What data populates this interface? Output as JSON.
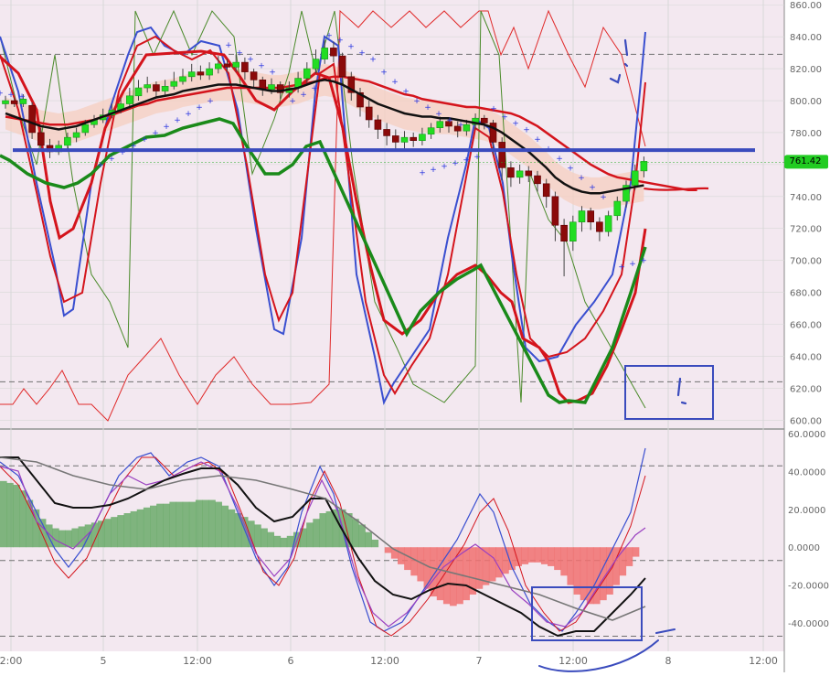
{
  "colors": {
    "background": "#ffffff",
    "pane_fill": "#f3e8f0",
    "grid": "#d7d7d7",
    "dashed_level": "#707070",
    "candle_up": "#22dd22",
    "candle_down": "#8b0a0a",
    "ma_black": "#111111",
    "ma_red": "#d4141c",
    "ma_green": "#1a8a1a",
    "osc_blue": "#3a4fd0",
    "psar_blue": "#2a36e0",
    "zigzag_red": "#e02a2a",
    "zigzag_green": "#4a8a2a",
    "annotation_blue": "#3a4bbd",
    "price_tag_bg": "#22cc22",
    "hist_red": "#f07070",
    "hist_green": "#6aaa6a",
    "envelope_fill": "#f5cfc0"
  },
  "chart_data": [
    {
      "type": "line",
      "pane": "price",
      "y_ticks": [
        "860.00",
        "840.00",
        "820.00",
        "800.00",
        "780.00",
        "760.00",
        "740.00",
        "720.00",
        "700.00",
        "680.00",
        "660.00",
        "640.00",
        "620.00",
        "600.00"
      ],
      "ylim": [
        595,
        863
      ],
      "x_ticks": [
        "2:00",
        "5",
        "12:00",
        "6",
        "12:00",
        "7",
        "12:00",
        "8",
        "12:00"
      ],
      "current_price_label": "761.42",
      "current_price": 761.42,
      "dashed_levels": [
        829,
        624
      ],
      "horizontal_line": 769,
      "candles": [
        {
          "o": 798,
          "c": 800,
          "h": 803,
          "l": 795
        },
        {
          "o": 800,
          "c": 798,
          "h": 802,
          "l": 796
        },
        {
          "o": 798,
          "c": 801,
          "h": 804,
          "l": 796
        },
        {
          "o": 797,
          "c": 780,
          "h": 799,
          "l": 776
        },
        {
          "o": 780,
          "c": 772,
          "h": 783,
          "l": 768
        },
        {
          "o": 772,
          "c": 768,
          "h": 776,
          "l": 764
        },
        {
          "o": 768,
          "c": 772,
          "h": 775,
          "l": 766
        },
        {
          "o": 772,
          "c": 777,
          "h": 780,
          "l": 770
        },
        {
          "o": 777,
          "c": 780,
          "h": 783,
          "l": 774
        },
        {
          "o": 780,
          "c": 785,
          "h": 788,
          "l": 778
        },
        {
          "o": 785,
          "c": 788,
          "h": 791,
          "l": 783
        },
        {
          "o": 788,
          "c": 791,
          "h": 795,
          "l": 786
        },
        {
          "o": 791,
          "c": 794,
          "h": 798,
          "l": 789
        },
        {
          "o": 794,
          "c": 798,
          "h": 802,
          "l": 792
        },
        {
          "o": 798,
          "c": 803,
          "h": 808,
          "l": 795
        },
        {
          "o": 803,
          "c": 808,
          "h": 813,
          "l": 800
        },
        {
          "o": 808,
          "c": 810,
          "h": 815,
          "l": 805
        },
        {
          "o": 810,
          "c": 806,
          "h": 812,
          "l": 802
        },
        {
          "o": 806,
          "c": 809,
          "h": 813,
          "l": 803
        },
        {
          "o": 809,
          "c": 812,
          "h": 818,
          "l": 807
        },
        {
          "o": 812,
          "c": 815,
          "h": 820,
          "l": 810
        },
        {
          "o": 815,
          "c": 818,
          "h": 823,
          "l": 812
        },
        {
          "o": 818,
          "c": 816,
          "h": 822,
          "l": 813
        },
        {
          "o": 816,
          "c": 820,
          "h": 824,
          "l": 813
        },
        {
          "o": 820,
          "c": 823,
          "h": 828,
          "l": 817
        },
        {
          "o": 823,
          "c": 821,
          "h": 826,
          "l": 818
        },
        {
          "o": 821,
          "c": 824,
          "h": 829,
          "l": 818
        },
        {
          "o": 824,
          "c": 818,
          "h": 827,
          "l": 813
        },
        {
          "o": 818,
          "c": 813,
          "h": 820,
          "l": 808
        },
        {
          "o": 813,
          "c": 807,
          "h": 815,
          "l": 803
        },
        {
          "o": 807,
          "c": 810,
          "h": 814,
          "l": 804
        },
        {
          "o": 810,
          "c": 805,
          "h": 812,
          "l": 801
        },
        {
          "o": 805,
          "c": 808,
          "h": 812,
          "l": 802
        },
        {
          "o": 808,
          "c": 814,
          "h": 818,
          "l": 805
        },
        {
          "o": 814,
          "c": 820,
          "h": 824,
          "l": 811
        },
        {
          "o": 820,
          "c": 826,
          "h": 832,
          "l": 817
        },
        {
          "o": 826,
          "c": 833,
          "h": 838,
          "l": 823
        },
        {
          "o": 833,
          "c": 828,
          "h": 837,
          "l": 824
        },
        {
          "o": 828,
          "c": 815,
          "h": 830,
          "l": 810
        },
        {
          "o": 815,
          "c": 805,
          "h": 818,
          "l": 800
        },
        {
          "o": 805,
          "c": 796,
          "h": 808,
          "l": 790
        },
        {
          "o": 796,
          "c": 788,
          "h": 800,
          "l": 783
        },
        {
          "o": 788,
          "c": 782,
          "h": 791,
          "l": 776
        },
        {
          "o": 782,
          "c": 778,
          "h": 786,
          "l": 772
        },
        {
          "o": 778,
          "c": 774,
          "h": 782,
          "l": 768
        },
        {
          "o": 774,
          "c": 777,
          "h": 781,
          "l": 770
        },
        {
          "o": 777,
          "c": 775,
          "h": 780,
          "l": 771
        },
        {
          "o": 775,
          "c": 779,
          "h": 783,
          "l": 772
        },
        {
          "o": 779,
          "c": 783,
          "h": 786,
          "l": 776
        },
        {
          "o": 783,
          "c": 787,
          "h": 790,
          "l": 780
        },
        {
          "o": 787,
          "c": 784,
          "h": 789,
          "l": 780
        },
        {
          "o": 784,
          "c": 781,
          "h": 787,
          "l": 777
        },
        {
          "o": 781,
          "c": 785,
          "h": 788,
          "l": 778
        },
        {
          "o": 785,
          "c": 789,
          "h": 792,
          "l": 782
        },
        {
          "o": 789,
          "c": 786,
          "h": 791,
          "l": 782
        },
        {
          "o": 786,
          "c": 774,
          "h": 788,
          "l": 766
        },
        {
          "o": 774,
          "c": 758,
          "h": 777,
          "l": 750
        },
        {
          "o": 758,
          "c": 752,
          "h": 762,
          "l": 746
        },
        {
          "o": 752,
          "c": 756,
          "h": 760,
          "l": 748
        },
        {
          "o": 756,
          "c": 753,
          "h": 759,
          "l": 749
        },
        {
          "o": 753,
          "c": 748,
          "h": 756,
          "l": 743
        },
        {
          "o": 748,
          "c": 740,
          "h": 751,
          "l": 733
        },
        {
          "o": 740,
          "c": 722,
          "h": 743,
          "l": 712
        },
        {
          "o": 722,
          "c": 712,
          "h": 726,
          "l": 690
        },
        {
          "o": 712,
          "c": 724,
          "h": 728,
          "l": 706
        },
        {
          "o": 724,
          "c": 731,
          "h": 734,
          "l": 718
        },
        {
          "o": 731,
          "c": 724,
          "h": 733,
          "l": 719
        },
        {
          "o": 724,
          "c": 718,
          "h": 727,
          "l": 712
        },
        {
          "o": 718,
          "c": 728,
          "h": 731,
          "l": 715
        },
        {
          "o": 728,
          "c": 737,
          "h": 740,
          "l": 725
        },
        {
          "o": 737,
          "c": 747,
          "h": 750,
          "l": 733
        },
        {
          "o": 747,
          "c": 756,
          "h": 760,
          "l": 744
        },
        {
          "o": 756,
          "c": 762,
          "h": 765,
          "l": 752
        }
      ],
      "ma_black": [
        792,
        790,
        788,
        786,
        784,
        783,
        782,
        783,
        784,
        786,
        788,
        790,
        792,
        794,
        796,
        798,
        800,
        802,
        803,
        804,
        806,
        807,
        808,
        809,
        810,
        810,
        810,
        809,
        808,
        807,
        806,
        806,
        807,
        808,
        810,
        812,
        813,
        812,
        810,
        807,
        804,
        801,
        798,
        796,
        794,
        792,
        791,
        790,
        790,
        789,
        789,
        788,
        787,
        786,
        785,
        783,
        780,
        776,
        772,
        768,
        763,
        758,
        752,
        748,
        745,
        743,
        742,
        742,
        743,
        744,
        745,
        746,
        747
      ],
      "ma_red": [
        790,
        789,
        788,
        787,
        786,
        785,
        785,
        785,
        786,
        787,
        788,
        790,
        791,
        793,
        795,
        797,
        798,
        800,
        801,
        802,
        803,
        804,
        805,
        806,
        807,
        808,
        808,
        808,
        808,
        808,
        808,
        808,
        809,
        810,
        811,
        812,
        814,
        815,
        815,
        814,
        813,
        812,
        810,
        808,
        806,
        804,
        803,
        801,
        800,
        799,
        798,
        797,
        796,
        796,
        795,
        794,
        793,
        792,
        790,
        787,
        784,
        780,
        776,
        772,
        768,
        764,
        760,
        757,
        754,
        752,
        751,
        750,
        749,
        748,
        747,
        746,
        745,
        744,
        744
      ],
      "ma_green": [
        null,
        null,
        null,
        null,
        null,
        null,
        null,
        null,
        null,
        null,
        null,
        null,
        null,
        null,
        null,
        null,
        null,
        null,
        null,
        null,
        null,
        null,
        null,
        null,
        null,
        null,
        null,
        null,
        null,
        null,
        null,
        null,
        null,
        null,
        null,
        null,
        null,
        null,
        null,
        null,
        null,
        null,
        null,
        null,
        null,
        null,
        null,
        null,
        null,
        null,
        null,
        null,
        null,
        null,
        null,
        null,
        null,
        null,
        null,
        null,
        null,
        null,
        null,
        null,
        null,
        null,
        null,
        null,
        null,
        null,
        null,
        null,
        null
      ],
      "psar_upper": [
        [
          0,
          805
        ],
        [
          12,
          804
        ],
        [
          24,
          803
        ],
        [
          250,
          835
        ],
        [
          262,
          830
        ],
        [
          274,
          826
        ],
        [
          286,
          822
        ],
        [
          298,
          818
        ],
        [
          360,
          841
        ],
        [
          372,
          838
        ],
        [
          384,
          834
        ],
        [
          396,
          830
        ],
        [
          408,
          826
        ],
        [
          420,
          818
        ],
        [
          432,
          812
        ],
        [
          444,
          806
        ],
        [
          456,
          800
        ],
        [
          468,
          796
        ],
        [
          480,
          792
        ],
        [
          492,
          788
        ],
        [
          504,
          785
        ],
        [
          540,
          795
        ],
        [
          552,
          790
        ],
        [
          564,
          786
        ],
        [
          576,
          782
        ],
        [
          588,
          776
        ],
        [
          600,
          770
        ],
        [
          612,
          764
        ],
        [
          624,
          758
        ],
        [
          636,
          752
        ],
        [
          648,
          746
        ],
        [
          660,
          740
        ]
      ],
      "psar_lower": [
        [
          110,
          760
        ],
        [
          122,
          764
        ],
        [
          134,
          768
        ],
        [
          146,
          772
        ],
        [
          158,
          776
        ],
        [
          170,
          780
        ],
        [
          182,
          784
        ],
        [
          194,
          788
        ],
        [
          206,
          792
        ],
        [
          218,
          796
        ],
        [
          230,
          800
        ],
        [
          320,
          800
        ],
        [
          332,
          804
        ],
        [
          344,
          808
        ],
        [
          462,
          755
        ],
        [
          474,
          757
        ],
        [
          486,
          759
        ],
        [
          498,
          761
        ],
        [
          510,
          763
        ],
        [
          522,
          765
        ],
        [
          680,
          696
        ],
        [
          692,
          698
        ],
        [
          704,
          700
        ]
      ]
    },
    {
      "type": "area",
      "pane": "oscillator",
      "y_ticks": [
        "60.0000",
        "40.0000",
        "20.0000",
        "0.0000",
        "-20.0000",
        "-40.0000"
      ],
      "ylim": [
        -55,
        62
      ],
      "dashed_levels": [
        43,
        -7,
        -47
      ],
      "histogram": [
        35,
        34,
        33,
        30,
        25,
        20,
        15,
        12,
        10,
        9,
        9,
        10,
        11,
        12,
        13,
        14,
        15,
        16,
        17,
        18,
        19,
        20,
        21,
        22,
        23,
        23,
        24,
        24,
        24,
        24,
        25,
        25,
        25,
        24,
        22,
        20,
        18,
        16,
        14,
        12,
        10,
        8,
        6,
        5,
        6,
        8,
        10,
        13,
        15,
        18,
        19,
        20,
        20,
        18,
        15,
        12,
        8,
        4,
        0,
        -3,
        -6,
        -9,
        -12,
        -15,
        -18,
        -22,
        -26,
        -28,
        -30,
        -31,
        -30,
        -28,
        -25,
        -22,
        -20,
        -18,
        -16,
        -14,
        -12,
        -10,
        -9,
        -8,
        -8,
        -9,
        -10,
        -12,
        -15,
        -20,
        -25,
        -28,
        -30,
        -30,
        -28,
        -25,
        -20,
        -15,
        -10,
        -5,
        0
      ]
    }
  ]
}
